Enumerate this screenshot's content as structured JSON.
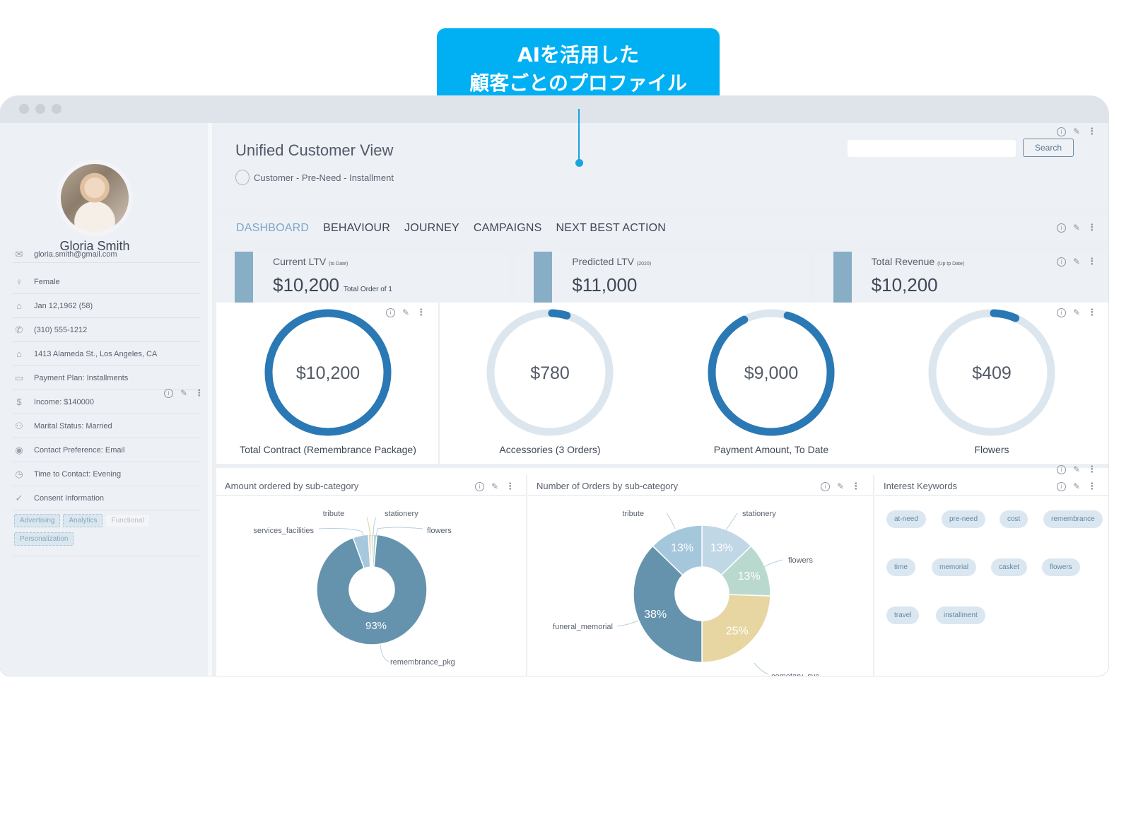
{
  "callout": {
    "line1": "AIを活用した",
    "line2": "顧客ごとのプロファイル"
  },
  "profile": {
    "name": "Gloria Smith",
    "fields": [
      {
        "icon": "mail-icon",
        "glyph": "✉",
        "text": "gloria.smith@gmail.com"
      },
      {
        "icon": "person-icon",
        "glyph": "♀",
        "text": "Female"
      },
      {
        "icon": "birthday-cake-icon",
        "glyph": "⌂",
        "text": "Jan 12,1962 (58)"
      },
      {
        "icon": "phone-icon",
        "glyph": "✆",
        "text": "(310) 555-1212"
      },
      {
        "icon": "home-icon",
        "glyph": "⌂",
        "text": "1413 Alameda St., Los Angeles, CA"
      },
      {
        "icon": "payment-card-icon",
        "glyph": "▭",
        "text": "Payment Plan: Installments"
      },
      {
        "icon": "dollar-icon",
        "glyph": "$",
        "text": "Income: $140000"
      },
      {
        "icon": "family-icon",
        "glyph": "⚇",
        "text": "Marital Status: Married"
      },
      {
        "icon": "contact-pin-icon",
        "glyph": "◉",
        "text": "Contact Preference: Email"
      },
      {
        "icon": "clock-icon",
        "glyph": "◷",
        "text": "Time to Contact: Evening"
      },
      {
        "icon": "consent-check-icon",
        "glyph": "✓",
        "text": "Consent Information"
      }
    ],
    "consent_tags": [
      {
        "label": "Advertising",
        "active": true
      },
      {
        "label": "Analytics",
        "active": true
      },
      {
        "label": "Functional",
        "active": false
      },
      {
        "label": "Personalization",
        "active": true
      }
    ]
  },
  "header": {
    "title": "Unified Customer View",
    "breadcrumb": "Customer - Pre-Need - Installment",
    "search_placeholder": "",
    "search_label": "Search"
  },
  "tabs": [
    {
      "label": "DASHBOARD",
      "active": true
    },
    {
      "label": "BEHAVIOUR",
      "active": false
    },
    {
      "label": "JOURNEY",
      "active": false
    },
    {
      "label": "CAMPAIGNS",
      "active": false
    },
    {
      "label": "NEXT BEST ACTION",
      "active": false
    }
  ],
  "kpis": [
    {
      "label": "Current LTV",
      "note": "(to Date)",
      "value": "$10,200",
      "sub": "Total Order of 1"
    },
    {
      "label": "Predicted LTV",
      "note": "(2020)",
      "value": "$11,000",
      "sub": ""
    },
    {
      "label": "Total Revenue",
      "note": "(Up tp Date)",
      "value": "$10,200",
      "sub": ""
    }
  ],
  "gauges": [
    {
      "value": "$10,200",
      "label": "Total Contract (Remembrance Package)",
      "fraction": 1.0
    },
    {
      "value": "$780",
      "label": "Accessories (3 Orders)",
      "fraction": 0.04
    },
    {
      "value": "$9,000",
      "label": "Payment Amount, To Date",
      "fraction": 0.88
    },
    {
      "value": "$409",
      "label": "Flowers",
      "fraction": 0.06
    }
  ],
  "colors": {
    "accent": "#2a78b4",
    "track": "#dce6ee",
    "kpi_bar": "#88aec6",
    "callout": "#00b0f3"
  },
  "chart_data": [
    {
      "type": "pie",
      "title": "Amount ordered by sub-category",
      "categories": [
        "remembrance_pkg",
        "services_facilities",
        "tribute",
        "stationery",
        "flowers"
      ],
      "values": [
        93,
        4.5,
        0.8,
        0.7,
        1.0
      ],
      "labels_shown": [
        "93%",
        "",
        "",
        "",
        ""
      ],
      "colors": [
        "#6593ae",
        "#a5c8dd",
        "#e6d5a0",
        "#c9dbe7",
        "#b7d8cf"
      ]
    },
    {
      "type": "pie",
      "title": "Number of Orders by sub-category",
      "categories": [
        "stationery",
        "flowers",
        "cemetary_svc",
        "funeral_memorial",
        "tribute"
      ],
      "values": [
        13,
        13,
        25,
        38,
        13
      ],
      "labels_shown": [
        "13%",
        "13%",
        "25%",
        "38%",
        "13%"
      ],
      "colors": [
        "#c0d7e6",
        "#b9d9cf",
        "#e7d6a2",
        "#6593ae",
        "#a4c7dc"
      ]
    }
  ],
  "interest_keywords": {
    "title": "Interest Keywords",
    "items": [
      "at-need",
      "pre-need",
      "cost",
      "remembrance",
      "time",
      "memorial",
      "casket",
      "flowers",
      "travel",
      "installment"
    ]
  }
}
